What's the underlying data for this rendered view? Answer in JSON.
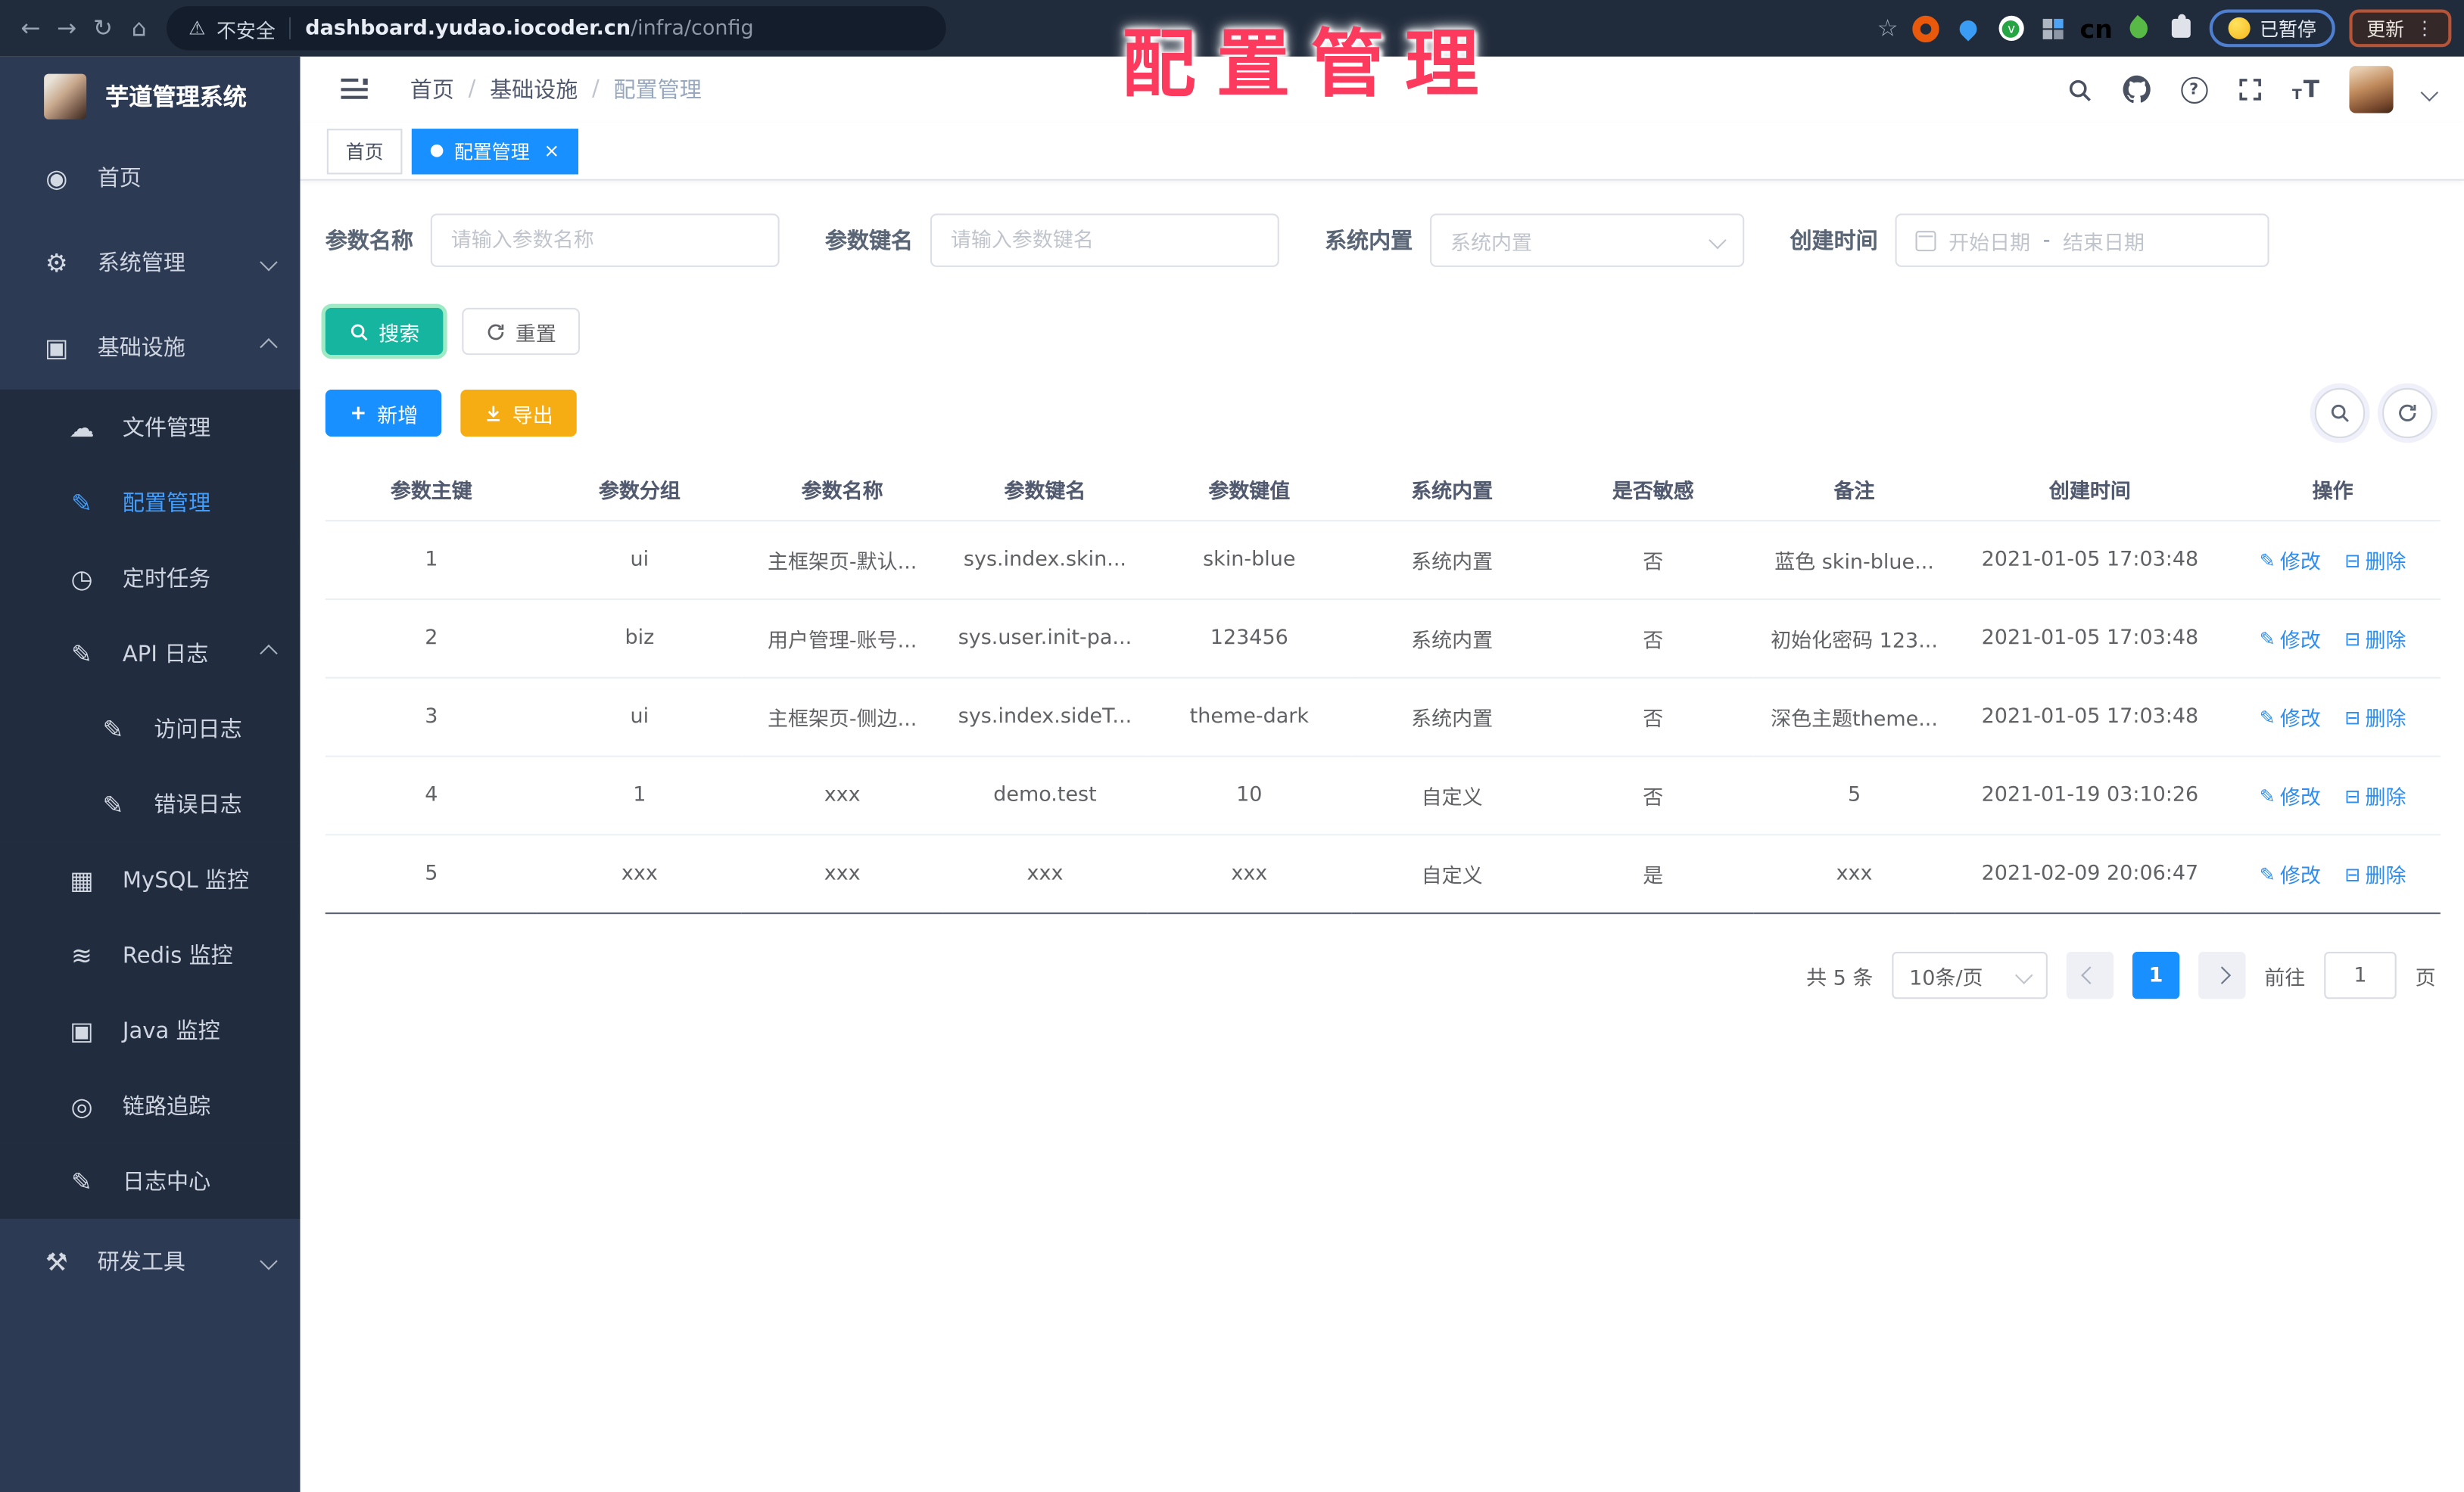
{
  "browser": {
    "security_label": "不安全",
    "url_host": "dashboard.yudao.iocoder.cn",
    "url_path": "/infra/config",
    "cn_badge": "cn",
    "paused_label": "已暂停",
    "update_label": "更新"
  },
  "watermark": "配置管理",
  "sidebar": {
    "title": "芋道管理系统",
    "items": [
      {
        "id": "home",
        "label": "首页",
        "icon": "dashboard-icon",
        "depth": 0
      },
      {
        "id": "system",
        "label": "系统管理",
        "icon": "gear-icon",
        "depth": 0,
        "chevron": "down"
      },
      {
        "id": "infra",
        "label": "基础设施",
        "icon": "monitor-icon",
        "depth": 0,
        "chevron": "up"
      },
      {
        "id": "file",
        "label": "文件管理",
        "icon": "cloud-icon",
        "depth": 1
      },
      {
        "id": "config",
        "label": "配置管理",
        "icon": "edit-square-icon",
        "depth": 1,
        "active": true
      },
      {
        "id": "job",
        "label": "定时任务",
        "icon": "clock-icon",
        "depth": 1
      },
      {
        "id": "api-log",
        "label": "API 日志",
        "icon": "log-icon",
        "depth": 1,
        "chevron": "up"
      },
      {
        "id": "access-log",
        "label": "访问日志",
        "icon": "log-icon",
        "depth": 2
      },
      {
        "id": "error-log",
        "label": "错误日志",
        "icon": "log-icon",
        "depth": 2
      },
      {
        "id": "mysql",
        "label": "MySQL 监控",
        "icon": "mysql-icon",
        "depth": 1
      },
      {
        "id": "redis",
        "label": "Redis 监控",
        "icon": "redis-icon",
        "depth": 1
      },
      {
        "id": "java",
        "label": "Java 监控",
        "icon": "java-icon",
        "depth": 1
      },
      {
        "id": "trace",
        "label": "链路追踪",
        "icon": "eye-icon",
        "depth": 1
      },
      {
        "id": "log-center",
        "label": "日志中心",
        "icon": "log-icon",
        "depth": 1
      },
      {
        "id": "devtools",
        "label": "研发工具",
        "icon": "tools-icon",
        "depth": 0,
        "chevron": "down"
      }
    ]
  },
  "header": {
    "breadcrumb": [
      "首页",
      "基础设施",
      "配置管理"
    ],
    "separator": "/"
  },
  "tabs": {
    "home_label": "首页",
    "active_label": "配置管理",
    "close_glyph": "×"
  },
  "filters": {
    "param_name_label": "参数名称",
    "param_name_placeholder": "请输入参数名称",
    "param_key_label": "参数键名",
    "param_key_placeholder": "请输入参数键名",
    "builtin_label": "系统内置",
    "builtin_placeholder": "系统内置",
    "create_time_label": "创建时间",
    "start_placeholder": "开始日期",
    "range_separator": "-",
    "end_placeholder": "结束日期"
  },
  "actions": {
    "search": "搜索",
    "reset": "重置",
    "add": "新增",
    "export": "导出"
  },
  "table": {
    "headers": [
      "参数主键",
      "参数分组",
      "参数名称",
      "参数键名",
      "参数键值",
      "系统内置",
      "是否敏感",
      "备注",
      "创建时间",
      "操作"
    ],
    "rows": [
      [
        "1",
        "ui",
        "主框架页-默认...",
        "sys.index.skin...",
        "skin-blue",
        "系统内置",
        "否",
        "蓝色 skin-blue...",
        "2021-01-05 17:03:48"
      ],
      [
        "2",
        "biz",
        "用户管理-账号...",
        "sys.user.init-pa...",
        "123456",
        "系统内置",
        "否",
        "初始化密码 123...",
        "2021-01-05 17:03:48"
      ],
      [
        "3",
        "ui",
        "主框架页-侧边...",
        "sys.index.sideT...",
        "theme-dark",
        "系统内置",
        "否",
        "深色主题theme...",
        "2021-01-05 17:03:48"
      ],
      [
        "4",
        "1",
        "xxx",
        "demo.test",
        "10",
        "自定义",
        "否",
        "5",
        "2021-01-19 03:10:26"
      ],
      [
        "5",
        "xxx",
        "xxx",
        "xxx",
        "xxx",
        "自定义",
        "是",
        "xxx",
        "2021-02-09 20:06:47"
      ]
    ],
    "op_edit": "修改",
    "op_delete": "删除"
  },
  "pagination": {
    "total": "共 5 条",
    "page_size": "10条/页",
    "current_page": "1",
    "goto_label": "前往",
    "goto_value": "1",
    "page_unit": "页"
  },
  "colors": {
    "accent_blue": "#1890ff",
    "teal_search": "#16b59f",
    "amber_export": "#f6ad14",
    "link_blue": "#2d8cf0",
    "watermark_red": "#fb3a5d",
    "sidebar_bg": "#2d3a53",
    "submenu_bg": "#212c3f",
    "chrome_bg": "#202b3b"
  }
}
